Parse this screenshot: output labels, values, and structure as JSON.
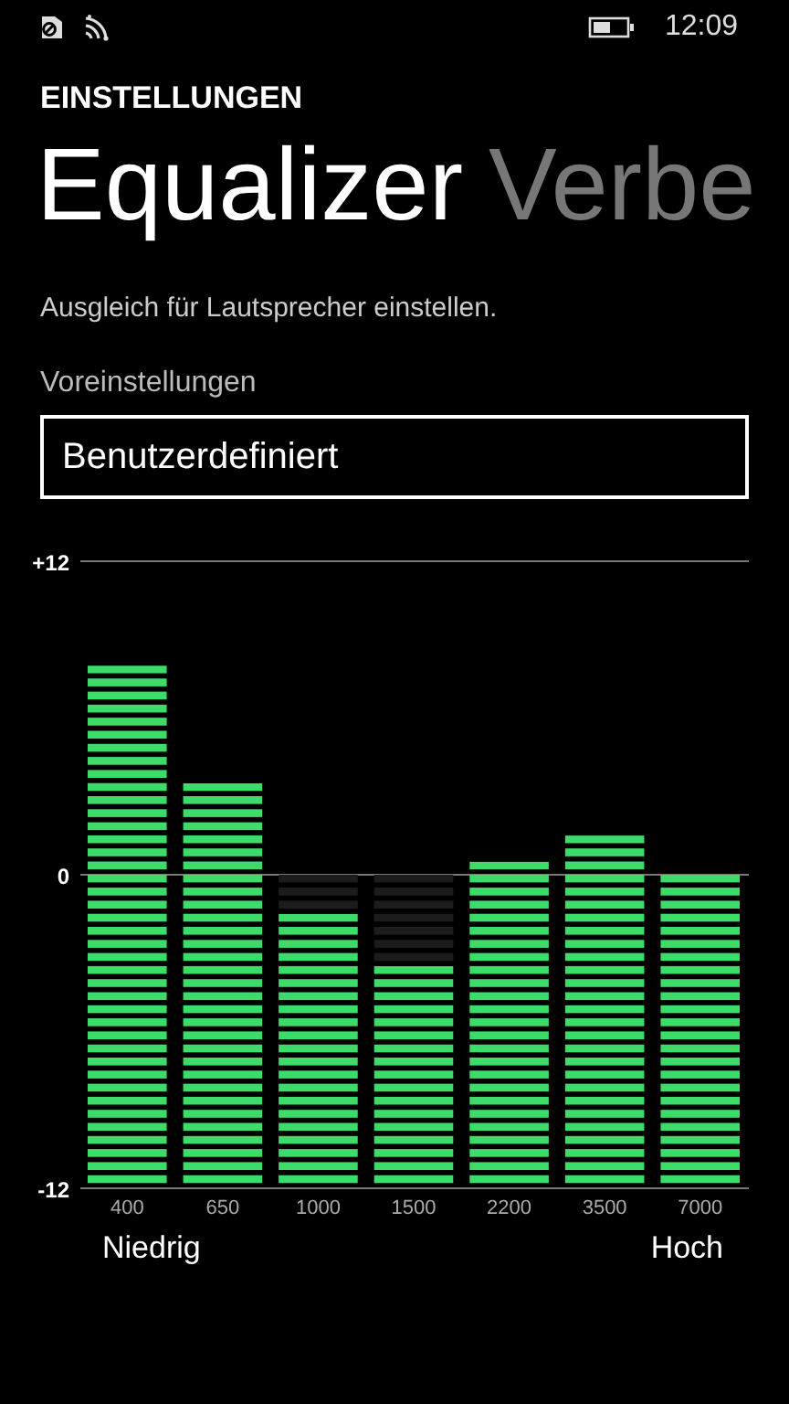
{
  "status_bar": {
    "time": "12:09"
  },
  "header": {
    "section": "EINSTELLUNGEN",
    "pivots": [
      {
        "label": "Equalizer",
        "selected": true
      },
      {
        "label": "Verbe",
        "selected": false
      }
    ]
  },
  "description": "Ausgleich für Lautsprecher einstellen.",
  "preset": {
    "label": "Voreinstellungen",
    "value": "Benutzerdefiniert"
  },
  "chart_data": {
    "type": "bar",
    "categories": [
      "400",
      "650",
      "1000",
      "1500",
      "2200",
      "3500",
      "7000"
    ],
    "series": [
      {
        "color": "#1c1c1c",
        "values": [
          0,
          0,
          -1.5,
          -3.5,
          0,
          0,
          0
        ]
      },
      {
        "color": "#3ddc6a",
        "values": [
          8,
          3.5,
          0,
          0,
          0.5,
          1.5,
          0
        ]
      },
      {
        "color": "#3ddc6a",
        "values": [
          -12,
          -12,
          -10.5,
          -8.5,
          -12,
          -12,
          -12
        ]
      }
    ],
    "stacked": true,
    "ylim": [
      -12,
      12
    ],
    "yticks": [
      {
        "value": 12,
        "label": "+12"
      },
      0,
      -12
    ]
  },
  "range_labels": {
    "low": "Niedrig",
    "high": "Hoch"
  }
}
